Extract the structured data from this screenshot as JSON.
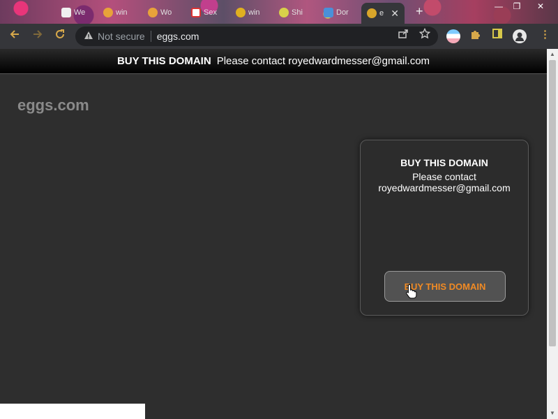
{
  "browser": {
    "tabs": [
      {
        "label": "We",
        "favicon_color": "#f0f0f0"
      },
      {
        "label": "win",
        "favicon_color": "#e8a23a"
      },
      {
        "label": "Wo",
        "favicon_color": "#e8a23a"
      },
      {
        "label": "Sex",
        "favicon_color": "#ffffff"
      },
      {
        "label": "win",
        "favicon_color": "#e0b020"
      },
      {
        "label": "Shi",
        "favicon_color": "#d8d04a"
      },
      {
        "label": "Dor",
        "favicon_color": "#4a90d9"
      },
      {
        "label": "e",
        "favicon_color": "#d9a62a",
        "active": true
      }
    ],
    "newtab_label": "+",
    "window_controls": {
      "minimize": "—",
      "maximize": "❐",
      "close": "✕"
    },
    "tab_close": "✕",
    "address": {
      "warning_icon": "warning-icon",
      "security_text": "Not secure",
      "url": "eggs.com"
    }
  },
  "page": {
    "banner": {
      "bold_text": "BUY THIS DOMAIN",
      "text": "Please contact royedwardmesser@gmail.com"
    },
    "site_name": "eggs.com",
    "card": {
      "title": "BUY THIS DOMAIN",
      "line1": "Please contact",
      "email": "royedwardmesser@gmail.com",
      "button_label": "BUY THIS DOMAIN"
    }
  },
  "colors": {
    "accent_button_text": "#f08a24",
    "page_background": "#2e2e2e",
    "nav_icons": "#d7a84a"
  }
}
